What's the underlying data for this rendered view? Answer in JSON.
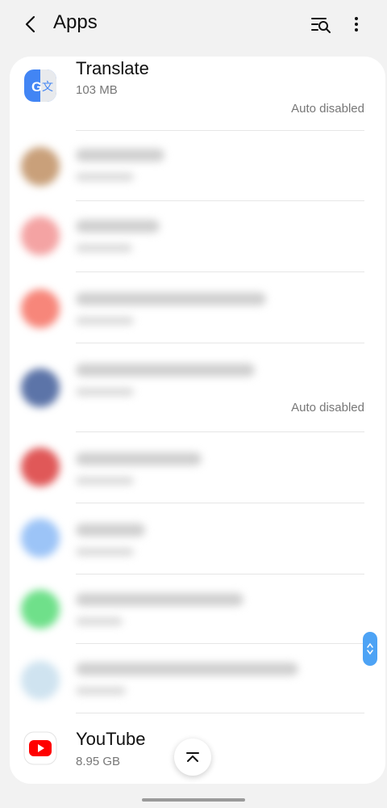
{
  "header": {
    "title": "Apps",
    "back_icon": "back-arrow-icon",
    "search_icon": "filter-search-icon",
    "more_icon": "more-vertical-icon"
  },
  "apps": {
    "translate": {
      "name": "Translate",
      "size": "103 MB",
      "status": "Auto disabled",
      "icon": "google-translate-icon"
    },
    "video_mp3": {
      "status": "Auto disabled"
    },
    "youtube": {
      "name": "YouTube",
      "size": "8.95 GB",
      "icon": "youtube-icon"
    }
  },
  "controls": {
    "scroll_to_top_icon": "scroll-to-top-icon",
    "fast_scroll_icon": "fast-scroll-handle"
  },
  "colors": {
    "background": "#f2f2f2",
    "card": "#ffffff",
    "accent_blue": "#4da3f5",
    "translate_blue": "#4285f4",
    "youtube_red": "#ff0000"
  }
}
